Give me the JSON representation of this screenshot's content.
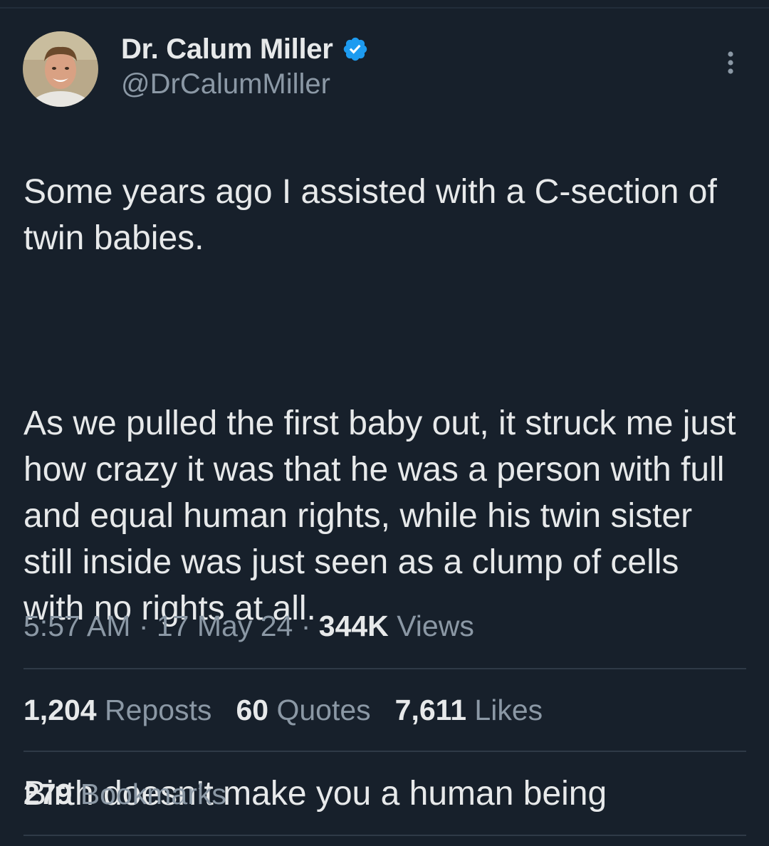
{
  "author": {
    "display_name": "Dr. Calum Miller",
    "handle": "@DrCalumMiller",
    "verified_color": "#1d9bf0"
  },
  "tweet": {
    "paragraph_1": "Some years ago I assisted with a C-section of twin babies.",
    "paragraph_2": "As we pulled the first baby out, it struck me just how crazy it was that he was a person with full and equal human rights, while his twin sister still inside was just seen as a clump of cells with no rights at all.",
    "paragraph_3": "Birth doesn’t make you a human being"
  },
  "meta": {
    "time": "5:57 AM",
    "separator": " · ",
    "date": "17 May 24",
    "views_count": "344K",
    "views_label": "Views"
  },
  "stats": {
    "reposts_count": "1,204",
    "reposts_label": "Reposts",
    "quotes_count": "60",
    "quotes_label": "Quotes",
    "likes_count": "7,611",
    "likes_label": "Likes",
    "bookmarks_count": "279",
    "bookmarks_label": "Bookmarks"
  },
  "icons": {
    "verified": "verified-badge-icon",
    "more": "more-options-icon"
  },
  "colors": {
    "background": "#17202b",
    "text_primary": "#e7e9ea",
    "text_secondary": "#8b98a5",
    "divider": "#2f3a47",
    "verified_blue": "#1d9bf0"
  }
}
